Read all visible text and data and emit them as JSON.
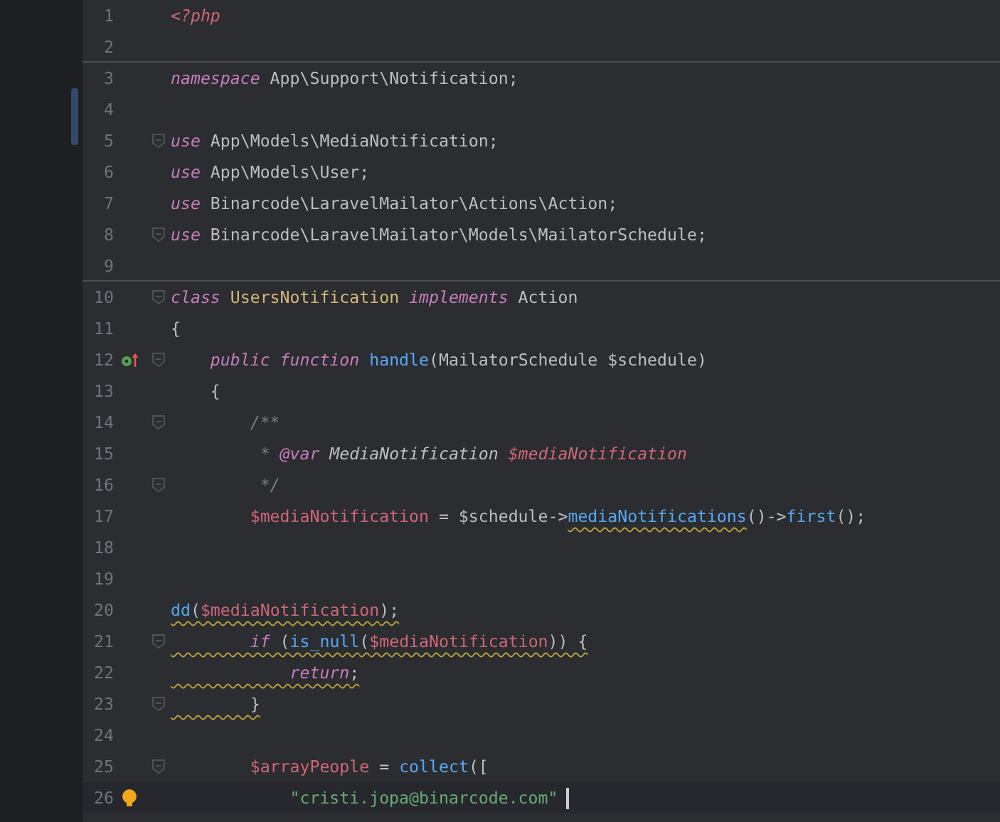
{
  "editor": {
    "lines": [
      {
        "number": "1",
        "fold": false,
        "current": false,
        "separator": false,
        "implemented": false,
        "bulb": false,
        "tokens": [
          {
            "kind": "tag",
            "text": "<?php"
          }
        ]
      },
      {
        "number": "2",
        "fold": false,
        "current": false,
        "separator": true,
        "implemented": false,
        "bulb": false
      },
      {
        "number": "3",
        "fold": false,
        "current": false,
        "separator": false,
        "implemented": false,
        "bulb": false,
        "tokens": [
          {
            "kind": "keyword",
            "text": "namespace"
          },
          {
            "kind": "plain",
            "text": " App\\Support\\Notification;"
          }
        ]
      },
      {
        "number": "4",
        "fold": false,
        "current": false,
        "separator": false,
        "implemented": false,
        "bulb": false
      },
      {
        "number": "5",
        "fold": true,
        "current": false,
        "separator": false,
        "implemented": false,
        "bulb": false,
        "tokens": [
          {
            "kind": "keyword",
            "text": "use"
          },
          {
            "kind": "plain",
            "text": " App\\Models\\MediaNotification;"
          }
        ]
      },
      {
        "number": "6",
        "fold": false,
        "current": false,
        "separator": false,
        "implemented": false,
        "bulb": false,
        "tokens": [
          {
            "kind": "keyword",
            "text": "use"
          },
          {
            "kind": "plain",
            "text": " App\\Models\\User;"
          }
        ]
      },
      {
        "number": "7",
        "fold": false,
        "current": false,
        "separator": false,
        "implemented": false,
        "bulb": false,
        "tokens": [
          {
            "kind": "keyword",
            "text": "use"
          },
          {
            "kind": "plain",
            "text": " Binarcode\\LaravelMailator\\Actions\\Action;"
          }
        ]
      },
      {
        "number": "8",
        "fold": true,
        "current": false,
        "separator": false,
        "implemented": false,
        "bulb": false,
        "tokens": [
          {
            "kind": "keyword",
            "text": "use"
          },
          {
            "kind": "plain",
            "text": " Binarcode\\LaravelMailator\\Models\\MailatorSchedule;"
          }
        ]
      },
      {
        "number": "9",
        "fold": false,
        "current": false,
        "separator": true,
        "implemented": false,
        "bulb": false
      },
      {
        "number": "10",
        "fold": true,
        "current": false,
        "separator": false,
        "implemented": false,
        "bulb": false,
        "tokens": [
          {
            "kind": "keyword",
            "text": "class"
          },
          {
            "kind": "classname",
            "text": " UsersNotification"
          },
          {
            "kind": "keyword",
            "text": " implements"
          },
          {
            "kind": "plain",
            "text": " Action"
          }
        ]
      },
      {
        "number": "11",
        "fold": false,
        "current": false,
        "separator": false,
        "implemented": false,
        "bulb": false,
        "tokens": [
          {
            "kind": "plain",
            "text": "{"
          }
        ]
      },
      {
        "number": "12",
        "fold": true,
        "current": false,
        "separator": false,
        "implemented": true,
        "bulb": false,
        "tokens": [
          {
            "kind": "keyword",
            "text": "    public function"
          },
          {
            "kind": "function",
            "text": " handle"
          },
          {
            "kind": "plain",
            "text": "(MailatorSchedule $schedule)"
          }
        ]
      },
      {
        "number": "13",
        "fold": false,
        "current": false,
        "separator": false,
        "implemented": false,
        "bulb": false,
        "tokens": [
          {
            "kind": "plain",
            "text": "    {"
          }
        ]
      },
      {
        "number": "14",
        "fold": true,
        "current": false,
        "separator": false,
        "implemented": false,
        "bulb": false,
        "tokens": [
          {
            "kind": "comment",
            "text": "        /**"
          }
        ]
      },
      {
        "number": "15",
        "fold": false,
        "current": false,
        "separator": false,
        "implemented": false,
        "bulb": false,
        "tokens": [
          {
            "kind": "comment",
            "text": "         * "
          },
          {
            "kind": "doctag",
            "text": "@var"
          },
          {
            "kind": "doctype",
            "text": " MediaNotification "
          },
          {
            "kind": "docvar",
            "text": "$mediaNotification"
          }
        ]
      },
      {
        "number": "16",
        "fold": true,
        "current": false,
        "separator": false,
        "implemented": false,
        "bulb": false,
        "tokens": [
          {
            "kind": "comment",
            "text": "         */"
          }
        ]
      },
      {
        "number": "17",
        "fold": false,
        "current": false,
        "separator": false,
        "implemented": false,
        "bulb": false,
        "tokens": [
          {
            "kind": "variable",
            "text": "        $mediaNotification"
          },
          {
            "kind": "plain",
            "text": " = $schedule->"
          },
          {
            "kind": "function",
            "text": "mediaNotifications",
            "warn": true
          },
          {
            "kind": "plain",
            "text": "()->"
          },
          {
            "kind": "function",
            "text": "first"
          },
          {
            "kind": "plain",
            "text": "();"
          }
        ]
      },
      {
        "number": "18",
        "fold": false,
        "current": false,
        "separator": false,
        "implemented": false,
        "bulb": false
      },
      {
        "number": "19",
        "fold": false,
        "current": false,
        "separator": false,
        "implemented": false,
        "bulb": false
      },
      {
        "number": "20",
        "fold": false,
        "current": false,
        "separator": false,
        "implemented": false,
        "bulb": false,
        "tokens": [
          {
            "kind": "function",
            "text": "dd",
            "warn": true
          },
          {
            "kind": "plain",
            "text": "(",
            "warn": true
          },
          {
            "kind": "variable",
            "text": "$mediaNotification",
            "warn": true
          },
          {
            "kind": "plain",
            "text": ");",
            "warn": true
          }
        ]
      },
      {
        "number": "21",
        "fold": true,
        "current": false,
        "separator": false,
        "implemented": false,
        "bulb": false,
        "tokens": [
          {
            "kind": "keyword",
            "text": "        if",
            "warn": true
          },
          {
            "kind": "plain",
            "text": " (",
            "warn": true
          },
          {
            "kind": "function",
            "text": "is_null",
            "warn": true
          },
          {
            "kind": "plain",
            "text": "(",
            "warn": true
          },
          {
            "kind": "variable",
            "text": "$mediaNotification",
            "warn": true
          },
          {
            "kind": "plain",
            "text": ")) {",
            "warn": true
          }
        ]
      },
      {
        "number": "22",
        "fold": false,
        "current": false,
        "separator": false,
        "implemented": false,
        "bulb": false,
        "tokens": [
          {
            "kind": "keyword",
            "text": "            return",
            "warn": true
          },
          {
            "kind": "plain",
            "text": ";",
            "warn": true
          }
        ]
      },
      {
        "number": "23",
        "fold": true,
        "current": false,
        "separator": false,
        "implemented": false,
        "bulb": false,
        "tokens": [
          {
            "kind": "plain",
            "text": "        }",
            "warn": true
          }
        ]
      },
      {
        "number": "24",
        "fold": false,
        "current": false,
        "separator": false,
        "implemented": false,
        "bulb": false
      },
      {
        "number": "25",
        "fold": true,
        "current": false,
        "separator": false,
        "implemented": false,
        "bulb": false,
        "tokens": [
          {
            "kind": "variable",
            "text": "        $arrayPeople"
          },
          {
            "kind": "plain",
            "text": " = "
          },
          {
            "kind": "function",
            "text": "collect"
          },
          {
            "kind": "plain",
            "text": "(["
          }
        ]
      },
      {
        "number": "26",
        "fold": false,
        "current": true,
        "separator": false,
        "implemented": false,
        "bulb": true,
        "tokens": [
          {
            "kind": "string",
            "text": "            \"cristi.jopa@binarcode.com\""
          }
        ]
      }
    ]
  }
}
